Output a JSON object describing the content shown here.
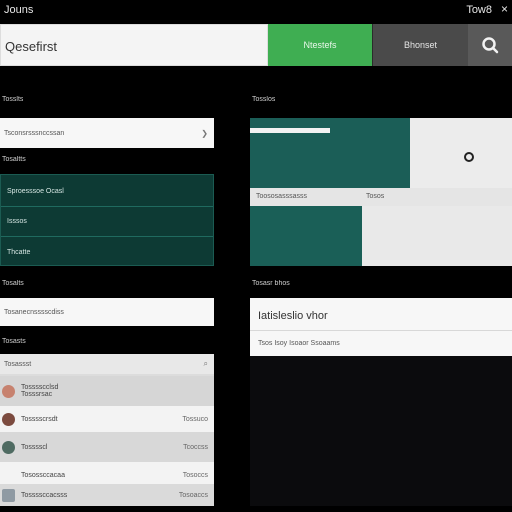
{
  "header": {
    "app_title": "Jouns",
    "right_text": "Tow8",
    "close_glyph": "×"
  },
  "search": {
    "value": "Qesefirst",
    "primary_button": "Ntestefs",
    "secondary_button": "Bhonset"
  },
  "left": {
    "section1": {
      "label": "Tosslts",
      "field": "Tsconsrsssnccssan"
    },
    "section2": {
      "label": "Tosaltts",
      "rows": [
        "Sproesssoe Ocasl",
        "Isssos",
        "Thcatte"
      ]
    },
    "section3": {
      "label": "Tosalts",
      "field": "Tosanecnsssscdiss"
    },
    "section4": {
      "label": "Tosasts",
      "search_placeholder": "Tosassst",
      "contacts": [
        {
          "name": "Tosssscclsd",
          "detail": "Tosssrsac",
          "right": "",
          "avatar": "#c7826f"
        },
        {
          "name": "Tosssscrsdt",
          "detail": "",
          "right": "Tossuco",
          "avatar": "#7c4b3f"
        },
        {
          "name": "Tosssscl",
          "detail": "",
          "right": "Tcoccss",
          "avatar": "#4f6b62"
        },
        {
          "name": "Tosossccacaa",
          "detail": "",
          "right": "Tosoccs",
          "avatar": ""
        },
        {
          "name": "Tossssccacsss",
          "detail": "",
          "right": "Tosoaccs",
          "avatar": "#8f9aa3"
        }
      ]
    }
  },
  "right": {
    "preview_label": "Tosslos",
    "tile_mid_left": "Toososasssasss",
    "tile_mid_right": "Tosos",
    "card_label": "Tosasr bhos",
    "card_title": "Iatisleslio vhor",
    "card_subtitle": "Tsos Isoy Isoaor Ssoaams"
  },
  "colors": {
    "accent_green": "#3fae52",
    "teal_dark": "#0d3a34",
    "teal_tile": "#1b5e57"
  }
}
